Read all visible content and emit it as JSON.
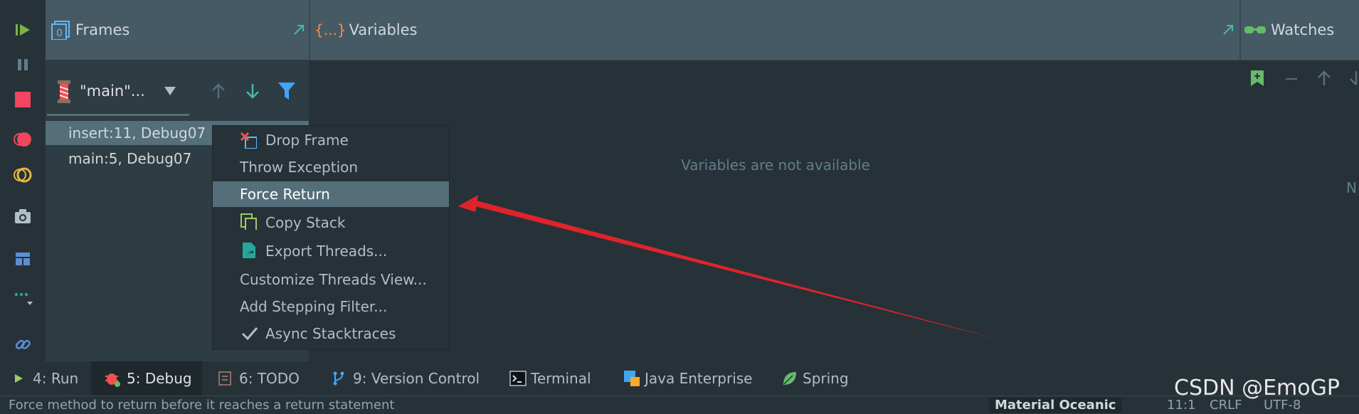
{
  "header": {
    "frames_title": "Frames",
    "variables_icon_text": "{...}",
    "variables_title": "Variables",
    "watches_title": "Watches"
  },
  "frames": {
    "thread_label": "\"main\"...",
    "rows": [
      {
        "label": "insert:11, Debug07"
      },
      {
        "label": "main:5, Debug07"
      }
    ]
  },
  "variables": {
    "empty_message": "Variables are not available"
  },
  "watches": {
    "partial_text": "N"
  },
  "context_menu": {
    "items": [
      {
        "label": "Drop Frame",
        "icon": "drop-frame-icon"
      },
      {
        "label": "Throw Exception",
        "icon": ""
      },
      {
        "label": "Force Return",
        "icon": "",
        "selected": true
      },
      {
        "label": "Copy Stack",
        "icon": "copy-icon"
      },
      {
        "label": "Export Threads...",
        "icon": "export-icon"
      },
      {
        "label": "Customize Threads View...",
        "icon": ""
      },
      {
        "label": "Add Stepping Filter...",
        "icon": ""
      },
      {
        "label": "Async Stacktraces",
        "icon": "checkmark-icon"
      }
    ]
  },
  "bottom_tabs": [
    {
      "label": "4: Run",
      "active": false
    },
    {
      "label": "5: Debug",
      "active": true
    },
    {
      "label": "6: TODO",
      "active": false
    },
    {
      "label": "9: Version Control",
      "active": false
    },
    {
      "label": "Terminal",
      "active": false
    },
    {
      "label": "Java Enterprise",
      "active": false
    },
    {
      "label": "Spring",
      "active": false
    }
  ],
  "status_bar": {
    "message": "Force method to return before it reaches a return statement",
    "theme_label": "Material Oceanic",
    "position": "11:1",
    "line_sep": "CRLF",
    "encoding": "UTF-8"
  },
  "watermark": "CSDN @EmoGP",
  "colors": {
    "accent_red": "#e53935",
    "selection": "#546e7a",
    "header_bg": "#455a64",
    "panel_bg": "#263238"
  }
}
